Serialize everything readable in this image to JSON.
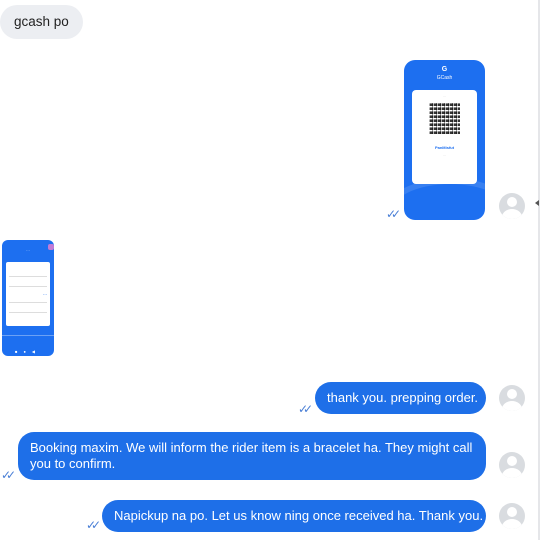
{
  "messages": [
    {
      "direction": "incoming",
      "type": "text",
      "text": "gcash po"
    },
    {
      "direction": "outgoing",
      "type": "image",
      "image": {
        "logo": "G",
        "brand": "GCash",
        "payee_name": "PanMisfut"
      }
    },
    {
      "direction": "incoming",
      "type": "image"
    },
    {
      "direction": "outgoing",
      "type": "text",
      "text": "thank you. prepping order."
    },
    {
      "direction": "outgoing",
      "type": "text",
      "text": "Booking maxim. We will inform the rider item is a bracelet ha. They might call you to confirm."
    },
    {
      "direction": "outgoing",
      "type": "text",
      "text": "Napickup na po. Let us know ning once received ha. Thank you."
    }
  ],
  "receipt_icon": "double-check-icon",
  "avatar_icon": "default-avatar-icon",
  "colors": {
    "outgoing_bubble": "#1e6fe8",
    "incoming_bubble": "#eceef2",
    "check": "#4a7fd6",
    "gcash_blue": "#1d6ff0"
  }
}
